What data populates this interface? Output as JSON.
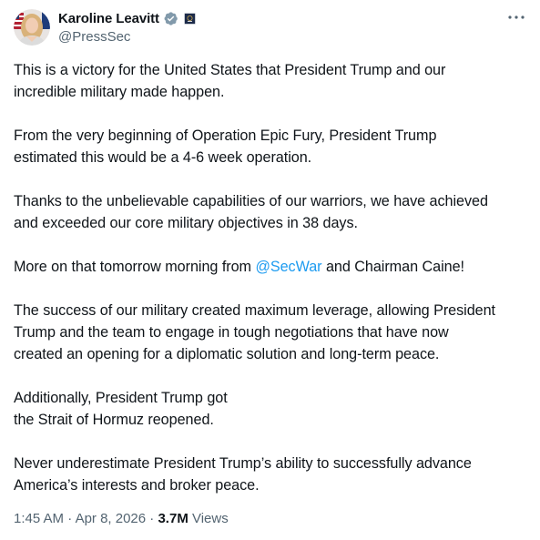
{
  "user": {
    "display_name": "Karoline Leavitt",
    "handle": "@PressSec",
    "verified_icon": "verified-badge-icon",
    "affiliation_icon": "government-affiliation-icon",
    "avatar": "profile-avatar"
  },
  "more_icon": "more-options-icon",
  "tweet": {
    "p1": "This is a victory for the United States that President Trump and our\nincredible military made happen.",
    "p2": "From the very beginning of Operation Epic Fury, President Trump\nestimated this would be a 4-6 week operation.",
    "p3": "Thanks to the unbelievable capabilities of our warriors, we have achieved\nand exceeded our core military objectives in 38 days.",
    "p4_before": "More on that tomorrow morning from ",
    "p4_mention": "@SecWar",
    "p4_after": " and Chairman Caine!",
    "p5": "The success of our military created maximum leverage, allowing President\nTrump and the team to engage in tough negotiations that have now\ncreated an opening for a diplomatic solution and long-term peace.",
    "p6": "Additionally, President Trump got\nthe Strait of Hormuz reopened.",
    "p7": "Never underestimate President Trump’s ability to successfully advance\nAmerica’s interests and broker peace."
  },
  "meta": {
    "time": "1:45 AM",
    "separator": " · ",
    "date": "Apr 8, 2026",
    "views_count": "3.7M",
    "views_label": " Views"
  },
  "colors": {
    "text": "#0f1419",
    "secondary": "#536471",
    "link": "#1d9bf0",
    "verified": "#829aab"
  }
}
